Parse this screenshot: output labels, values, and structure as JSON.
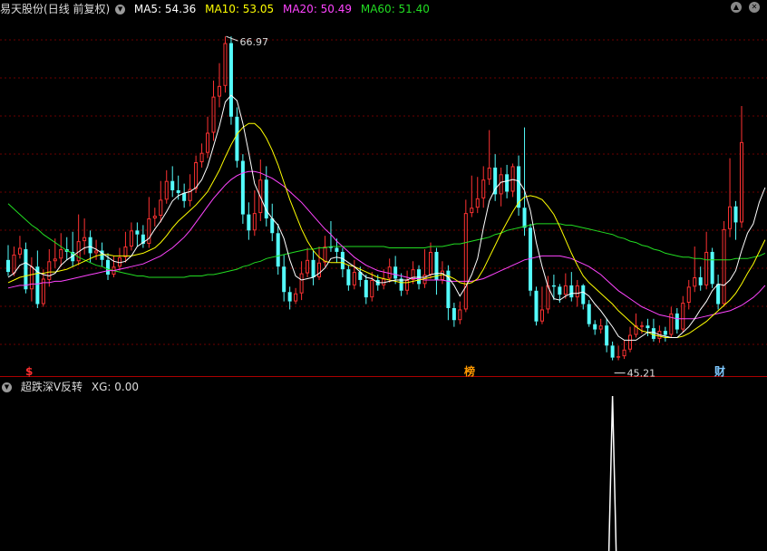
{
  "header": {
    "stock_name": "易天股份",
    "period": "(日线 前复权)",
    "ma5": {
      "label": "MA5: 54.36",
      "color": "#ffffff"
    },
    "ma10": {
      "label": "MA10: 53.05",
      "color": "#ffff00"
    },
    "ma20": {
      "label": "MA20: 50.49",
      "color": "#ff44ff"
    },
    "ma60": {
      "label": "MA60: 51.40",
      "color": "#22dd22"
    }
  },
  "indicator": {
    "name": "超跌深V反转",
    "xg": "XG: 0.00"
  },
  "markers": {
    "dollar": "$",
    "bang": "榜",
    "cai": "财"
  },
  "annotations": {
    "high_label": "66.97",
    "low_label": "45.21"
  },
  "colors": {
    "up": "#ff3232",
    "down": "#54fcfc",
    "grid": "#6b0000",
    "axis": "#aa0000"
  },
  "icons": [
    "dropdown-icon",
    "up-arrow-icon",
    "close-icon"
  ],
  "chart_data": {
    "type": "candlestick",
    "y_range": [
      42.5,
      68.5
    ],
    "series_names": [
      "MA5",
      "MA10",
      "MA20",
      "MA60"
    ],
    "candles": [
      [
        50.3,
        49.4,
        51.4,
        49.1
      ],
      [
        49.3,
        50.7,
        51.3,
        49.1
      ],
      [
        50.7,
        51.2,
        52.1,
        50.4
      ],
      [
        51.1,
        48.1,
        51.6,
        47.8
      ],
      [
        48.1,
        49.8,
        50.5,
        47.2
      ],
      [
        49.8,
        47.0,
        51.0,
        46.7
      ],
      [
        47.0,
        48.9,
        49.6,
        46.8
      ],
      [
        48.8,
        50.2,
        51.1,
        48.3
      ],
      [
        50.2,
        50.4,
        51.9,
        49.7
      ],
      [
        50.4,
        51.1,
        52.3,
        49.8
      ],
      [
        51.1,
        50.9,
        52.0,
        50.3
      ],
      [
        50.9,
        50.2,
        52.4,
        49.8
      ],
      [
        50.2,
        51.7,
        53.7,
        49.9
      ],
      [
        51.7,
        52.0,
        53.4,
        50.7
      ],
      [
        52.0,
        50.8,
        52.5,
        50.1
      ],
      [
        50.8,
        51.0,
        51.8,
        50.3
      ],
      [
        51.0,
        50.3,
        51.6,
        49.8
      ],
      [
        50.3,
        49.2,
        50.8,
        48.8
      ],
      [
        49.2,
        49.8,
        50.6,
        49.0
      ],
      [
        49.8,
        50.5,
        51.2,
        49.5
      ],
      [
        50.5,
        51.3,
        52.4,
        50.1
      ],
      [
        51.3,
        52.5,
        53.1,
        51.0
      ],
      [
        52.5,
        52.2,
        53.1,
        51.3
      ],
      [
        52.2,
        51.5,
        52.9,
        51.2
      ],
      [
        51.5,
        53.4,
        55.0,
        51.2
      ],
      [
        53.4,
        53.6,
        54.2,
        52.8
      ],
      [
        53.6,
        54.8,
        56.2,
        53.1
      ],
      [
        54.8,
        56.2,
        57.0,
        54.5
      ],
      [
        56.2,
        55.5,
        57.3,
        55.0
      ],
      [
        55.5,
        55.3,
        56.6,
        54.8
      ],
      [
        55.3,
        54.7,
        56.0,
        54.2
      ],
      [
        54.7,
        55.6,
        56.7,
        54.3
      ],
      [
        55.6,
        57.6,
        58.1,
        55.3
      ],
      [
        57.6,
        58.3,
        59.0,
        57.2
      ],
      [
        58.3,
        59.8,
        61.0,
        57.9
      ],
      [
        59.8,
        62.5,
        63.7,
        59.2
      ],
      [
        62.5,
        63.3,
        65.0,
        61.7
      ],
      [
        63.3,
        66.5,
        67.0,
        62.8
      ],
      [
        66.5,
        61.0,
        67.0,
        60.4
      ],
      [
        61.0,
        57.7,
        61.7,
        57.2
      ],
      [
        57.7,
        53.7,
        58.2,
        53.0
      ],
      [
        53.7,
        52.5,
        54.6,
        51.8
      ],
      [
        52.5,
        53.8,
        55.5,
        52.1
      ],
      [
        53.8,
        56.3,
        57.8,
        53.2
      ],
      [
        56.3,
        53.4,
        57.3,
        52.8
      ],
      [
        53.4,
        52.3,
        54.5,
        51.7
      ],
      [
        52.3,
        49.8,
        53.0,
        49.2
      ],
      [
        49.8,
        47.9,
        50.7,
        47.2
      ],
      [
        47.9,
        47.2,
        48.3,
        46.6
      ],
      [
        47.2,
        47.8,
        48.2,
        47.0
      ],
      [
        47.8,
        49.3,
        50.2,
        47.3
      ],
      [
        49.3,
        50.3,
        51.2,
        49.0
      ],
      [
        50.3,
        49.0,
        51.0,
        48.4
      ],
      [
        49.0,
        50.1,
        51.3,
        48.8
      ],
      [
        50.1,
        51.3,
        52.1,
        49.8
      ],
      [
        51.3,
        51.2,
        53.2,
        50.9
      ],
      [
        51.2,
        50.9,
        51.9,
        50.1
      ],
      [
        50.9,
        49.6,
        51.2,
        49.0
      ],
      [
        49.6,
        48.4,
        49.9,
        48.0
      ],
      [
        48.4,
        49.4,
        50.3,
        48.1
      ],
      [
        49.4,
        48.8,
        49.8,
        48.3
      ],
      [
        48.8,
        47.5,
        49.2,
        47.0
      ],
      [
        47.5,
        48.8,
        49.4,
        47.2
      ],
      [
        48.8,
        48.4,
        49.2,
        48.0
      ],
      [
        48.4,
        48.9,
        49.6,
        48.1
      ],
      [
        48.9,
        49.8,
        50.4,
        48.6
      ],
      [
        49.8,
        48.9,
        50.6,
        48.5
      ],
      [
        48.9,
        48.0,
        49.3,
        47.6
      ],
      [
        48.0,
        48.8,
        49.5,
        47.7
      ],
      [
        48.8,
        49.6,
        50.2,
        48.5
      ],
      [
        49.6,
        48.5,
        49.9,
        48.1
      ],
      [
        48.5,
        49.2,
        51.1,
        48.2
      ],
      [
        49.2,
        50.9,
        51.6,
        48.9
      ],
      [
        50.9,
        48.8,
        51.2,
        47.7
      ],
      [
        48.8,
        49.5,
        50.2,
        48.5
      ],
      [
        49.5,
        46.7,
        49.9,
        45.8
      ],
      [
        46.7,
        45.8,
        47.1,
        45.3
      ],
      [
        45.8,
        46.6,
        47.2,
        45.5
      ],
      [
        46.6,
        53.8,
        54.8,
        46.4
      ],
      [
        53.8,
        54.2,
        56.6,
        53.5
      ],
      [
        54.2,
        54.9,
        56.5,
        53.8
      ],
      [
        54.9,
        56.3,
        57.3,
        54.2
      ],
      [
        56.3,
        57.2,
        60.0,
        55.9
      ],
      [
        57.2,
        55.2,
        58.2,
        54.7
      ],
      [
        55.2,
        56.7,
        57.2,
        54.3
      ],
      [
        56.7,
        55.4,
        57.4,
        54.9
      ],
      [
        55.4,
        57.3,
        57.5,
        55.0
      ],
      [
        57.3,
        54.2,
        58.1,
        53.6
      ],
      [
        54.2,
        52.7,
        60.2,
        52.1
      ],
      [
        52.7,
        48.0,
        53.0,
        47.6
      ],
      [
        48.0,
        45.7,
        48.3,
        45.4
      ],
      [
        45.7,
        46.6,
        48.3,
        45.5
      ],
      [
        46.6,
        48.4,
        49.1,
        46.3
      ],
      [
        48.4,
        48.3,
        49.2,
        47.3
      ],
      [
        48.3,
        47.7,
        48.5,
        47.1
      ],
      [
        47.7,
        48.4,
        49.3,
        47.4
      ],
      [
        48.4,
        47.5,
        49.4,
        47.2
      ],
      [
        47.5,
        48.4,
        48.8,
        46.8
      ],
      [
        48.4,
        47.0,
        48.5,
        46.6
      ],
      [
        47.0,
        45.5,
        47.3,
        45.3
      ],
      [
        45.5,
        45.1,
        45.8,
        44.7
      ],
      [
        45.1,
        45.4,
        45.9,
        44.8
      ],
      [
        45.4,
        43.9,
        45.9,
        43.4
      ],
      [
        43.9,
        43.0,
        44.2,
        42.8
      ],
      [
        43.0,
        43.1,
        43.9,
        42.8
      ],
      [
        43.1,
        43.6,
        44.3,
        42.9
      ],
      [
        43.6,
        44.7,
        45.3,
        43.4
      ],
      [
        44.7,
        45.4,
        46.3,
        44.5
      ],
      [
        45.4,
        45.4,
        45.7,
        44.8
      ],
      [
        45.4,
        45.2,
        45.9,
        44.6
      ],
      [
        45.2,
        44.4,
        45.9,
        44.2
      ],
      [
        44.4,
        45.0,
        45.4,
        44.1
      ],
      [
        45.0,
        44.7,
        45.3,
        44.2
      ],
      [
        44.7,
        46.3,
        46.8,
        44.5
      ],
      [
        46.3,
        45.1,
        46.7,
        44.8
      ],
      [
        45.1,
        47.1,
        47.6,
        44.9
      ],
      [
        47.1,
        48.3,
        48.8,
        46.6
      ],
      [
        48.3,
        49.0,
        51.3,
        47.9
      ],
      [
        49.0,
        48.4,
        49.8,
        48.0
      ],
      [
        48.4,
        50.9,
        52.4,
        48.1
      ],
      [
        50.9,
        48.5,
        51.2,
        48.2
      ],
      [
        48.5,
        47.0,
        49.2,
        46.6
      ],
      [
        47.0,
        52.6,
        53.2,
        46.8
      ],
      [
        52.6,
        54.3,
        57.9,
        52.0
      ],
      [
        54.3,
        53.1,
        54.7,
        51.8
      ],
      [
        53.1,
        59.1,
        61.8,
        52.7
      ]
    ],
    "ma5": [
      49.0,
      49.3,
      49.9,
      50.1,
      49.8,
      49.4,
      49.2,
      49.1,
      49.3,
      49.9,
      50.3,
      50.6,
      50.9,
      51.2,
      51.3,
      51.1,
      50.8,
      50.5,
      50.2,
      50.1,
      50.2,
      50.6,
      51.3,
      51.6,
      51.9,
      52.6,
      53.2,
      53.9,
      54.7,
      55.1,
      55.3,
      55.4,
      55.7,
      56.3,
      57.3,
      58.8,
      60.3,
      62.1,
      62.6,
      62.2,
      60.5,
      58.3,
      56.0,
      55.0,
      54.0,
      53.4,
      52.9,
      51.9,
      50.3,
      49.1,
      48.8,
      48.9,
      49.0,
      49.3,
      49.7,
      50.4,
      50.5,
      50.4,
      50.1,
      49.8,
      49.4,
      49.0,
      48.9,
      48.6,
      48.6,
      48.7,
      48.8,
      48.8,
      48.8,
      49.0,
      49.0,
      49.0,
      49.2,
      49.3,
      49.3,
      49.0,
      48.4,
      47.6,
      48.3,
      49.2,
      50.4,
      52.7,
      54.7,
      55.6,
      56.1,
      56.2,
      56.3,
      56.2,
      55.5,
      54.0,
      51.6,
      49.8,
      48.3,
      47.4,
      47.3,
      47.6,
      47.8,
      47.8,
      47.9,
      47.6,
      47.0,
      46.5,
      45.9,
      45.3,
      44.6,
      44.3,
      44.3,
      44.3,
      44.6,
      44.9,
      44.9,
      44.7,
      44.6,
      44.5,
      44.5,
      44.9,
      45.3,
      45.9,
      46.6,
      47.2,
      48.0,
      48.5,
      48.4,
      48.8,
      49.5,
      51.0,
      52.3,
      53.0,
      54.6,
      55.7
    ],
    "ma10": [
      48.6,
      48.8,
      49.0,
      49.1,
      49.2,
      49.3,
      49.3,
      49.4,
      49.4,
      49.5,
      49.6,
      49.8,
      50.0,
      50.2,
      50.4,
      50.6,
      50.7,
      50.7,
      50.6,
      50.6,
      50.6,
      50.6,
      50.7,
      50.8,
      51.0,
      51.2,
      51.6,
      52.1,
      52.7,
      53.2,
      53.6,
      54.0,
      54.4,
      54.9,
      55.4,
      56.2,
      57.0,
      58.0,
      58.9,
      59.7,
      60.2,
      60.5,
      60.5,
      60.1,
      59.4,
      58.5,
      57.4,
      56.1,
      54.8,
      53.7,
      52.6,
      51.7,
      51.0,
      50.5,
      50.2,
      50.1,
      50.1,
      50.1,
      49.9,
      49.8,
      49.6,
      49.4,
      49.2,
      49.0,
      48.9,
      48.8,
      48.7,
      48.6,
      48.6,
      48.7,
      48.8,
      48.9,
      49.0,
      49.1,
      49.2,
      49.1,
      48.9,
      48.6,
      48.5,
      48.6,
      48.9,
      49.6,
      50.5,
      51.4,
      52.3,
      53.1,
      53.9,
      54.6,
      55.0,
      55.1,
      55.0,
      54.8,
      54.3,
      53.7,
      52.8,
      51.8,
      50.8,
      49.9,
      49.1,
      48.6,
      48.2,
      47.8,
      47.4,
      47.0,
      46.5,
      46.1,
      45.7,
      45.3,
      45.0,
      44.9,
      44.7,
      44.6,
      44.5,
      44.5,
      44.5,
      44.6,
      44.8,
      45.1,
      45.4,
      45.7,
      46.1,
      46.5,
      46.9,
      47.3,
      47.8,
      48.5,
      49.3,
      50.0,
      50.9,
      51.8
    ],
    "ma20": [
      48.2,
      48.3,
      48.4,
      48.4,
      48.5,
      48.5,
      48.6,
      48.6,
      48.7,
      48.7,
      48.8,
      48.9,
      49.0,
      49.1,
      49.2,
      49.3,
      49.4,
      49.5,
      49.5,
      49.6,
      49.7,
      49.8,
      49.9,
      50.0,
      50.2,
      50.4,
      50.6,
      50.9,
      51.2,
      51.6,
      52.0,
      52.5,
      53.1,
      53.7,
      54.3,
      54.9,
      55.4,
      55.9,
      56.3,
      56.6,
      56.8,
      56.9,
      56.9,
      56.8,
      56.6,
      56.4,
      56.1,
      55.8,
      55.4,
      55.0,
      54.6,
      54.1,
      53.6,
      53.1,
      52.6,
      52.2,
      51.7,
      51.3,
      50.9,
      50.5,
      50.2,
      49.9,
      49.7,
      49.5,
      49.4,
      49.3,
      49.2,
      49.1,
      49.0,
      48.9,
      48.9,
      48.8,
      48.8,
      48.8,
      48.8,
      48.7,
      48.7,
      48.7,
      48.7,
      48.7,
      48.8,
      48.9,
      49.1,
      49.3,
      49.5,
      49.7,
      49.9,
      50.1,
      50.3,
      50.4,
      50.5,
      50.6,
      50.6,
      50.6,
      50.6,
      50.5,
      50.4,
      50.2,
      50.0,
      49.8,
      49.5,
      49.2,
      48.8,
      48.4,
      48.0,
      47.7,
      47.4,
      47.1,
      46.8,
      46.6,
      46.4,
      46.2,
      46.1,
      46.0,
      45.9,
      45.9,
      45.9,
      45.9,
      46.0,
      46.1,
      46.2,
      46.3,
      46.4,
      46.5,
      46.7,
      46.9,
      47.2,
      47.5,
      47.9,
      48.4
    ],
    "ma60": [
      54.5,
      54.1,
      53.7,
      53.3,
      52.9,
      52.6,
      52.2,
      51.9,
      51.6,
      51.3,
      51.0,
      50.8,
      50.5,
      50.3,
      50.1,
      49.9,
      49.8,
      49.6,
      49.5,
      49.4,
      49.3,
      49.2,
      49.1,
      49.1,
      49.0,
      49.0,
      49.0,
      49.0,
      49.0,
      49.0,
      49.0,
      49.1,
      49.1,
      49.1,
      49.2,
      49.2,
      49.3,
      49.4,
      49.5,
      49.6,
      49.8,
      49.9,
      50.1,
      50.2,
      50.4,
      50.5,
      50.6,
      50.7,
      50.8,
      50.9,
      51.0,
      51.1,
      51.1,
      51.2,
      51.2,
      51.3,
      51.3,
      51.3,
      51.3,
      51.3,
      51.3,
      51.3,
      51.3,
      51.3,
      51.3,
      51.2,
      51.2,
      51.2,
      51.2,
      51.2,
      51.2,
      51.2,
      51.3,
      51.3,
      51.3,
      51.4,
      51.5,
      51.5,
      51.6,
      51.7,
      51.8,
      51.9,
      52.0,
      52.2,
      52.3,
      52.5,
      52.6,
      52.7,
      52.8,
      52.9,
      53.0,
      53.0,
      53.0,
      53.0,
      53.0,
      52.9,
      52.9,
      52.8,
      52.7,
      52.6,
      52.5,
      52.4,
      52.3,
      52.2,
      52.0,
      51.9,
      51.7,
      51.6,
      51.4,
      51.3,
      51.1,
      51.0,
      50.8,
      50.7,
      50.6,
      50.5,
      50.5,
      50.4,
      50.4,
      50.3,
      50.3,
      50.3,
      50.3,
      50.3,
      50.4,
      50.4,
      50.4,
      50.5,
      50.6,
      50.8
    ]
  }
}
